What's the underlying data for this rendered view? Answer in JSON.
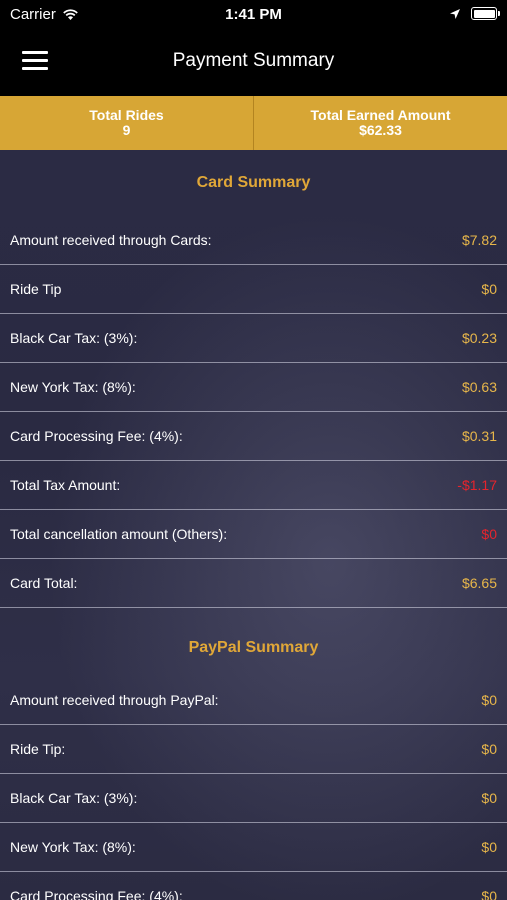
{
  "status_bar": {
    "carrier": "Carrier",
    "time": "1:41 PM"
  },
  "nav": {
    "title": "Payment Summary"
  },
  "stats": {
    "total_rides_label": "Total Rides",
    "total_rides_value": "9",
    "total_earned_label": "Total Earned Amount",
    "total_earned_value": "$62.33"
  },
  "card_summary": {
    "title": "Card Summary",
    "rows": [
      {
        "label": "Amount received through Cards:",
        "value": "$7.82"
      },
      {
        "label": "Ride Tip",
        "value": "$0"
      },
      {
        "label": "Black Car Tax: (3%):",
        "value": "$0.23"
      },
      {
        "label": "New York Tax: (8%):",
        "value": "$0.63"
      },
      {
        "label": "Card Processing Fee: (4%):",
        "value": "$0.31"
      },
      {
        "label": "Total Tax Amount:",
        "value": "-$1.17"
      },
      {
        "label": "Total cancellation amount (Others):",
        "value": "$0"
      },
      {
        "label": "Card Total:",
        "value": "$6.65"
      }
    ]
  },
  "paypal_summary": {
    "title": "PayPal Summary",
    "rows": [
      {
        "label": "Amount received through PayPal:",
        "value": "$0"
      },
      {
        "label": "Ride Tip:",
        "value": "$0"
      },
      {
        "label": "Black Car Tax: (3%):",
        "value": "$0"
      },
      {
        "label": "New York Tax: (8%):",
        "value": "$0"
      },
      {
        "label": "Card Processing Fee: (4%):",
        "value": "$0"
      }
    ]
  },
  "colors": {
    "accent": "#d7a635",
    "value": "#e7b64a",
    "negative": "#e5242d"
  }
}
